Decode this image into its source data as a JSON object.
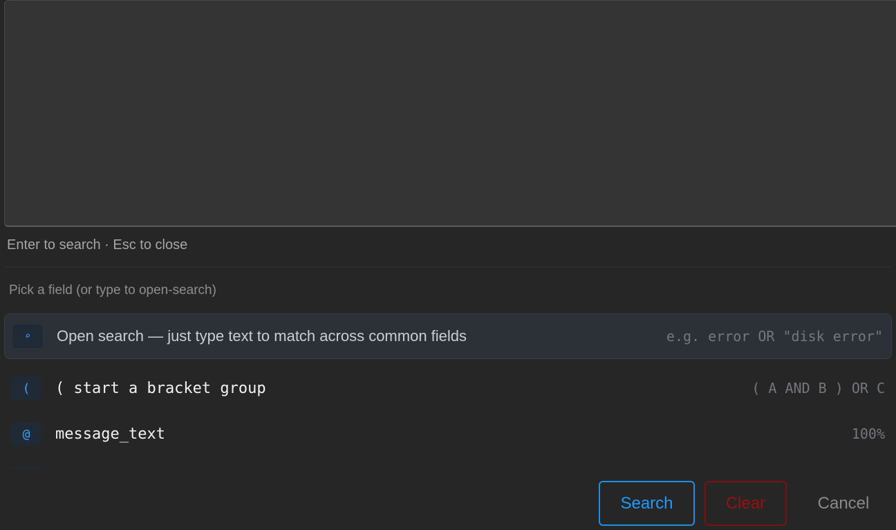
{
  "query": {
    "value": "",
    "placeholder": ""
  },
  "hint": "Enter to search · Esc to close",
  "section_label": "Pick a field (or type to open-search)",
  "suggestions": [
    {
      "icon": "⌕",
      "icon_name": "search-icon",
      "label": "Open search — just type text to match across common fields",
      "right": "e.g. error OR \"disk error\""
    },
    {
      "icon": "(",
      "icon_name": "bracket-icon",
      "label": "( start a bracket group",
      "right": "( A AND B ) OR C"
    },
    {
      "icon": "@",
      "icon_name": "field-icon",
      "label": "message_text",
      "right": "100%"
    }
  ],
  "buttons": {
    "search": "Search",
    "clear": "Clear",
    "cancel": "Cancel"
  },
  "colors": {
    "accent": "#1e9bff",
    "danger": "#9c0f0f",
    "background": "#262626"
  }
}
